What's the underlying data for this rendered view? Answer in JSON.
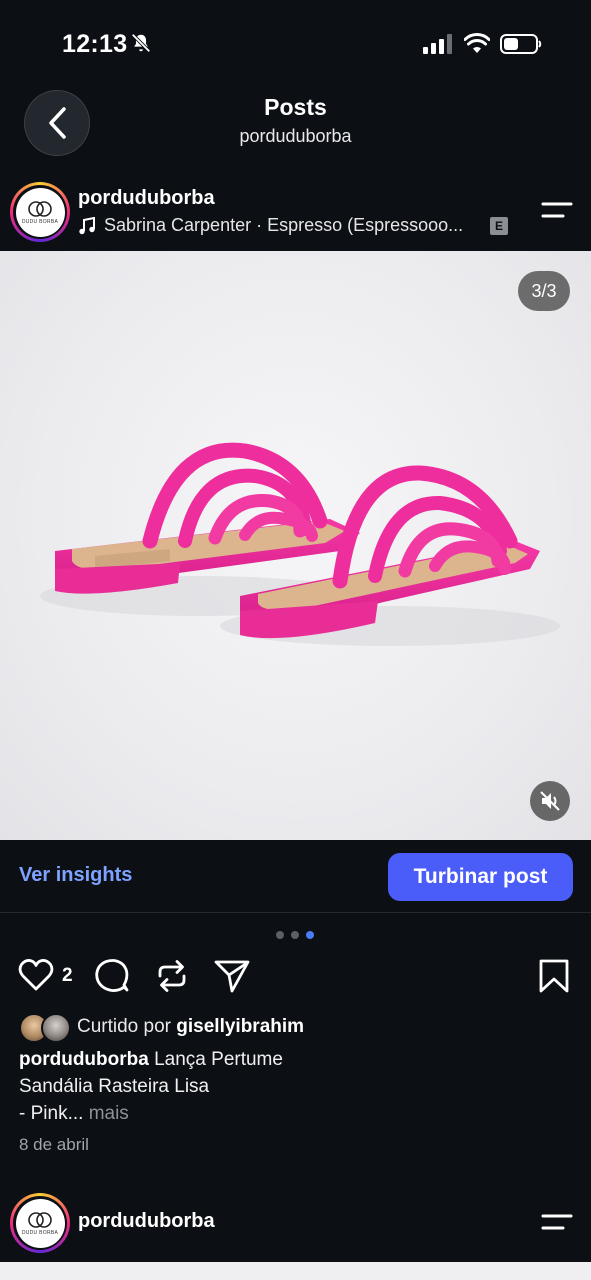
{
  "status_bar": {
    "time": "12:13",
    "icons": [
      "bell-slash-icon",
      "cellular-signal-icon",
      "wifi-icon",
      "battery-icon"
    ]
  },
  "header": {
    "title": "Posts",
    "subtitle": "porduduborba",
    "back_icon": "chevron-left-icon"
  },
  "post": {
    "username": "porduduborba",
    "avatar_text": "DUDU BORBA",
    "music": {
      "icon": "music-note-icon",
      "text": "Sabrina Carpenter · Espresso (Espressooo...",
      "explicit_badge": "E"
    },
    "media": {
      "counter": "3/3",
      "mute_icon": "speaker-muted-icon",
      "dots": {
        "total": 3,
        "active_index": 2
      }
    },
    "insights_label": "Ver insights",
    "boost_label": "Turbinar post",
    "actions": {
      "like_icon": "heart-icon",
      "like_count": "2",
      "comment_icon": "comment-icon",
      "repost_icon": "repost-icon",
      "share_icon": "send-icon",
      "save_icon": "bookmark-icon"
    },
    "likes": {
      "prefix": "Curtido por",
      "user": "gisellyibrahim"
    },
    "caption": {
      "user": "porduduborba",
      "line1": "Lança Pertume",
      "line2": "Sandália Rasteira Lisa",
      "line3": "- Pink...",
      "more": "mais"
    },
    "date": "8 de abril"
  },
  "next_post": {
    "username": "porduduborba"
  },
  "colors": {
    "background": "#0c1014",
    "accent_blue": "#4a5df9",
    "link_blue": "#7ea2ff",
    "sandal_pink": "#ef2b9d"
  }
}
